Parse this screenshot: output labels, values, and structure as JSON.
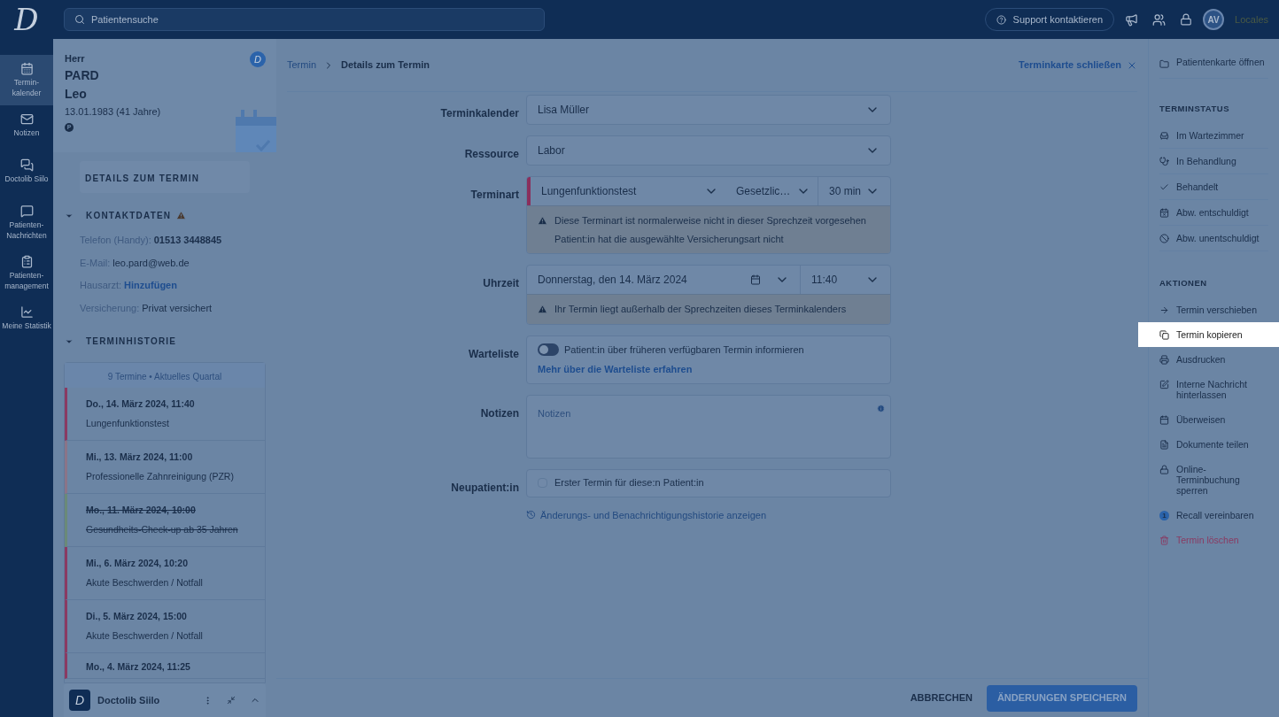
{
  "topbar": {
    "logo": "D",
    "search_placeholder": "Patientensuche",
    "support": "Support kontaktieren",
    "avatar": "AV",
    "locales": "Locales"
  },
  "nav": [
    {
      "label": "Termin-\nkalender",
      "selected": true
    },
    {
      "label": "Notizen",
      "selected": false
    },
    {
      "label": "Doctolib Siilo",
      "selected": false
    },
    {
      "label": "Patienten-\nNachrichten",
      "selected": false
    },
    {
      "label": "Patienten-\nmanagement",
      "selected": false
    },
    {
      "label": "Meine Statistik",
      "selected": false
    }
  ],
  "patient": {
    "salutation": "Herr",
    "last_name": "PARD",
    "first_name": "Leo",
    "birth": "13.01.1983 (41 Jahre)",
    "badge": "P",
    "logo_badge": "D",
    "details_title": "DETAILS ZUM TERMIN",
    "contact": {
      "title": "KONTAKTDATEN",
      "expanded": true,
      "fields": [
        {
          "label": "Telefon (Handy):",
          "value": "01513 3448845",
          "kind": "bold"
        },
        {
          "label": "E-Mail:",
          "value": "leo.pard@web.de",
          "kind": "text"
        },
        {
          "label": "Hausarzt:",
          "value": "Hinzufügen",
          "kind": "link"
        },
        {
          "label": "Versicherung:",
          "value": "Privat versichert",
          "kind": "text"
        }
      ]
    },
    "history": {
      "title": "TERMINHISTORIE",
      "expanded": true,
      "summary": "9 Termine • Aktuelles Quartal",
      "entries": [
        {
          "date": "Do., 14. März 2024, 11:40",
          "type": "Lungenfunktionstest",
          "color": "#8a3a62",
          "cancelled": false
        },
        {
          "date": "Mi., 13. März 2024, 11:00",
          "type": "Professionelle Zahnreinigung (PZR)",
          "color": "#8a7488",
          "cancelled": false
        },
        {
          "date": "Mo., 11. März 2024, 10:00",
          "type": "Gesundheits-Check-up ab 35 Jahren",
          "color": "#6a8a78",
          "cancelled": true
        },
        {
          "date": "Mi., 6. März 2024, 10:20",
          "type": "Akute Beschwerden / Notfall",
          "color": "#8a3a62",
          "cancelled": false
        },
        {
          "date": "Di., 5. März 2024, 15:00",
          "type": "Akute Beschwerden / Notfall",
          "color": "#8a3a62",
          "cancelled": false
        },
        {
          "date": "Mo., 4. März 2024, 11:25",
          "color": "#8a3a62",
          "cancelled": false
        }
      ]
    },
    "silo": "Doctolib Siilo",
    "silo_logo": "D"
  },
  "form": {
    "breadcrumb": [
      "Termin",
      "Details zum Termin"
    ],
    "close": "Terminkarte schließen",
    "calendar": {
      "label": "Terminkalender",
      "value": "Lisa Müller"
    },
    "resource": {
      "label": "Ressource",
      "value": "Labor"
    },
    "type": {
      "label": "Terminart",
      "value": "Lungenfunktionstest",
      "insurance": "Gesetzlic…",
      "duration": "30 min",
      "color": "#8a2f5c",
      "warnings": [
        "Diese Terminart ist normalerweise nicht in dieser Sprechzeit vorgesehen",
        "Patient:in hat die ausgewählte Versicherungsart nicht"
      ]
    },
    "time": {
      "label": "Uhrzeit",
      "date": "Donnerstag, den 14. März 2024",
      "time": "11:40",
      "warnings": [
        "Ihr Termin liegt außerhalb der Sprechzeiten dieses Terminkalenders"
      ]
    },
    "waitlist": {
      "label": "Warteliste",
      "on": false,
      "text": "Patient:in über früheren verfügbaren Termin informieren",
      "link": "Mehr über die Warteliste erfahren"
    },
    "notes": {
      "label": "Notizen",
      "placeholder": "Notizen"
    },
    "new_patient": {
      "label": "Neupatient:in",
      "checked": false,
      "text": "Erster Termin für diese:n Patient:in"
    },
    "history_link": "Änderungs- und Benachrichtigungshistorie anzeigen",
    "cancel": "ABBRECHEN",
    "save": "ÄNDERUNGEN SPEICHERN"
  },
  "actions_panel": {
    "open_card": "Patientenkarte öffnen",
    "status_title": "TERMINSTATUS",
    "status": [
      "Im Wartezimmer",
      "In Behandlung",
      "Behandelt",
      "Abw. entschuldigt",
      "Abw. unentschuldigt"
    ],
    "actions_title": "AKTIONEN",
    "actions": [
      {
        "label": "Termin verschieben",
        "selected": false,
        "kind": "normal"
      },
      {
        "label": "Termin kopieren",
        "selected": true,
        "kind": "normal"
      },
      {
        "label": "Ausdrucken",
        "selected": false,
        "kind": "normal"
      },
      {
        "label": "Interne Nachricht hinterlassen",
        "selected": false,
        "kind": "normal"
      },
      {
        "label": "Überweisen",
        "selected": false,
        "kind": "normal"
      },
      {
        "label": "Dokumente teilen",
        "selected": false,
        "kind": "normal"
      },
      {
        "label": "Online-Terminbuchung sperren",
        "selected": false,
        "kind": "normal"
      },
      {
        "label": "Recall vereinbaren",
        "selected": false,
        "kind": "normal",
        "badge": "1"
      },
      {
        "label": "Termin löschen",
        "selected": false,
        "kind": "danger"
      }
    ]
  }
}
